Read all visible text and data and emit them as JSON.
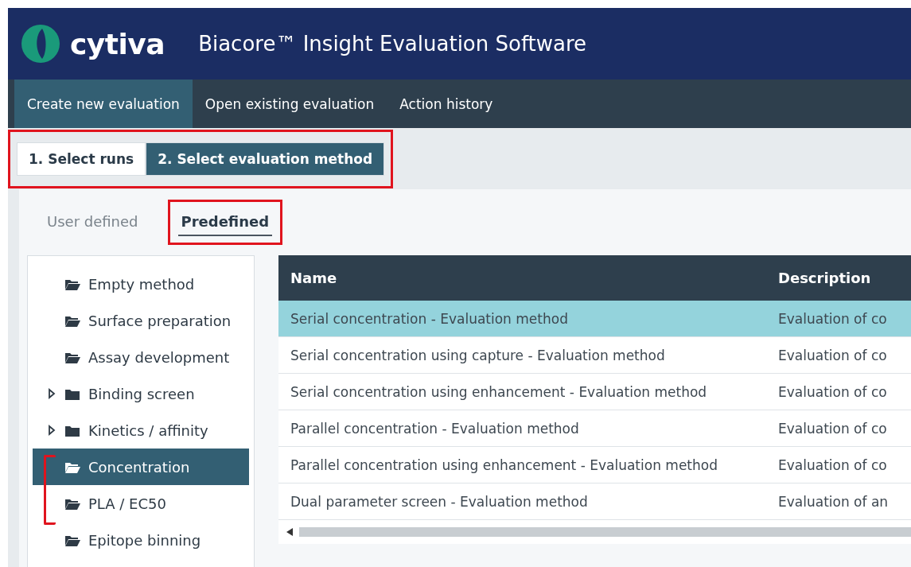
{
  "header": {
    "logo": "cytiva",
    "title": "Biacore™ Insight Evaluation Software"
  },
  "nav": [
    {
      "label": "Create new evaluation",
      "selected": true
    },
    {
      "label": "Open existing evaluation",
      "selected": false
    },
    {
      "label": "Action history",
      "selected": false
    }
  ],
  "steps": [
    {
      "label": "1. Select runs",
      "selected": false
    },
    {
      "label": "2. Select evaluation method",
      "selected": true
    }
  ],
  "method_tabs": [
    {
      "label": "User defined",
      "selected": false
    },
    {
      "label": "Predefined",
      "selected": true
    }
  ],
  "tree": [
    {
      "label": "Empty method",
      "kind": "leaf",
      "selected": false
    },
    {
      "label": "Surface preparation",
      "kind": "leaf",
      "selected": false
    },
    {
      "label": "Assay development",
      "kind": "leaf",
      "selected": false
    },
    {
      "label": "Binding screen",
      "kind": "group",
      "selected": false
    },
    {
      "label": "Kinetics / affinity",
      "kind": "group",
      "selected": false
    },
    {
      "label": "Concentration",
      "kind": "leaf",
      "selected": true
    },
    {
      "label": "PLA / EC50",
      "kind": "leaf",
      "selected": false
    },
    {
      "label": "Epitope binning",
      "kind": "leaf",
      "selected": false
    }
  ],
  "table": {
    "columns": [
      "Name",
      "Description"
    ],
    "rows": [
      {
        "cells": [
          "Serial concentration - Evaluation method",
          "Evaluation of co"
        ],
        "selected": true
      },
      {
        "cells": [
          "Serial concentration using capture - Evaluation method",
          "Evaluation of co"
        ],
        "selected": false
      },
      {
        "cells": [
          "Serial concentration using enhancement - Evaluation method",
          "Evaluation of co"
        ],
        "selected": false
      },
      {
        "cells": [
          "Parallel concentration - Evaluation method",
          "Evaluation of co"
        ],
        "selected": false
      },
      {
        "cells": [
          "Parallel concentration using enhancement - Evaluation method",
          "Evaluation of co"
        ],
        "selected": false
      },
      {
        "cells": [
          "Dual parameter screen - Evaluation method",
          "Evaluation of an"
        ],
        "selected": false
      }
    ]
  }
}
